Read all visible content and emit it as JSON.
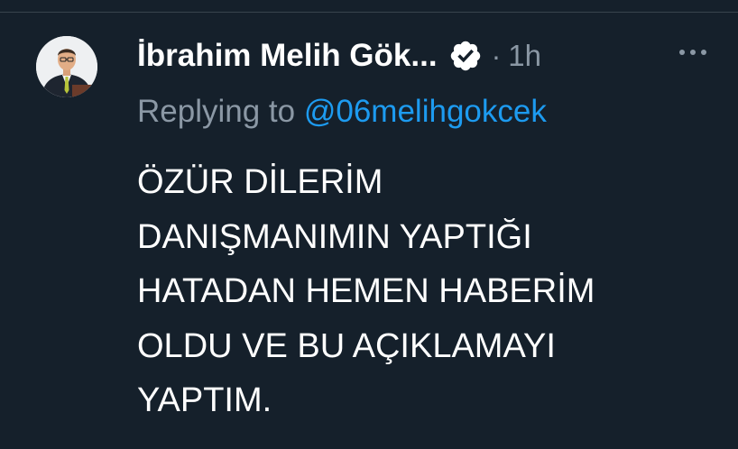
{
  "tweet": {
    "author": {
      "display_name": "İbrahim Melih Gök...",
      "verified_icon": "verified-badge-icon",
      "avatar": "profile-photo"
    },
    "separator": "·",
    "timestamp": "1h",
    "more_icon": "more-horizontal-icon",
    "reply": {
      "prefix": "Replying to",
      "handle": "@06melihgokcek"
    },
    "text_lines": [
      "ÖZÜR DİLERİM",
      "DANIŞMANIMIN YAPTIĞI",
      "HATADAN HEMEN HABERİM",
      "OLDU VE BU AÇIKLAMAYI",
      "YAPTIM."
    ]
  },
  "colors": {
    "background": "#15202b",
    "text_primary": "#ffffff",
    "text_secondary": "#8b98a5",
    "link": "#1d9bf0",
    "divider": "#38444d"
  }
}
